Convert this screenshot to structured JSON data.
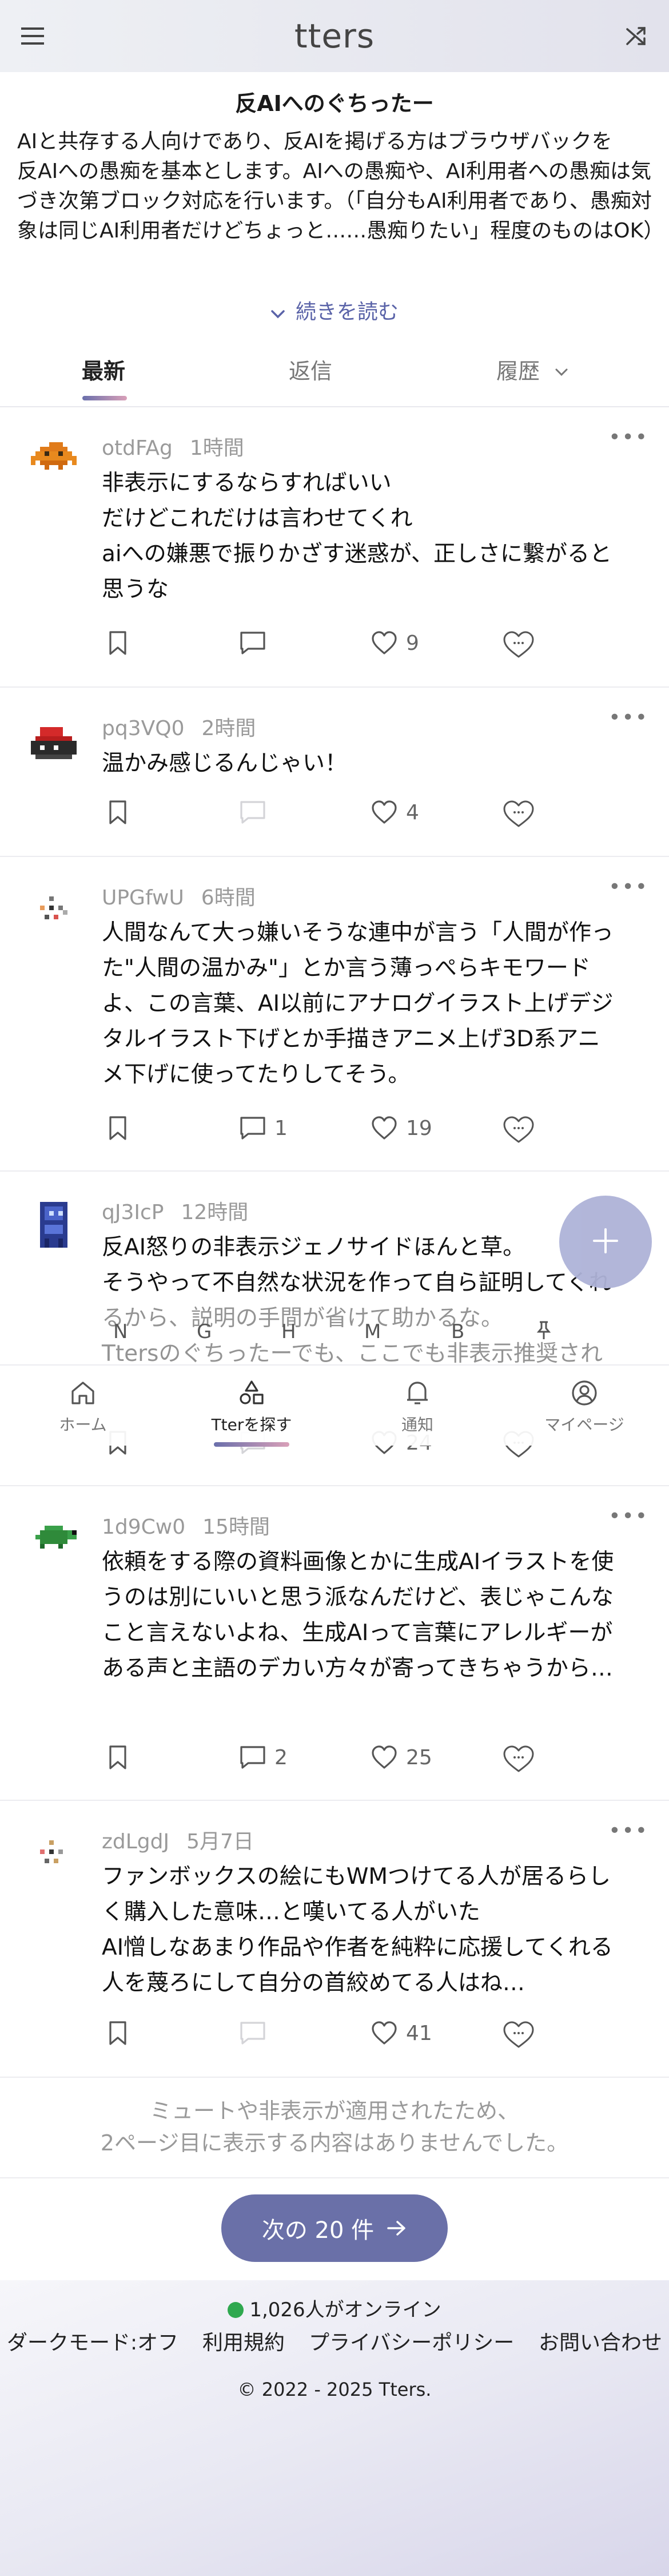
{
  "header": {
    "title": "tters",
    "menu_icon": "hamburger-menu-icon",
    "shuffle_icon": "shuffle-icon"
  },
  "board": {
    "title": "反AIへのぐちったー",
    "description_lines": [
      "AIと共存する人向けであり、反AIを掲げる方はブラウザバックを",
      "反AIへの愚痴を基本とします。AIへの愚痴や、AI利用者への愚痴は気づき次第ブロック対応を行います。（「自分もAI利用者であり、愚痴対象は同じAI利用者だけどちょっと……愚痴りたい」程度のものはOK）"
    ],
    "read_more": "続きを読む"
  },
  "tabs": {
    "latest": "最新",
    "reply": "返信",
    "history": "履歴"
  },
  "posts": [
    {
      "user": "otdFAg",
      "time": "1時間",
      "body": "非表示にするならすればいい\nだけどこれだけは言わせてくれ\naiへの嫌悪で振りかざす迷惑が、正しさに繋がると思うな",
      "comments": "",
      "likes": "9"
    },
    {
      "user": "pq3VQ0",
      "time": "2時間",
      "body": "温かみ感じるんじゃい！",
      "comments": "",
      "likes": "4"
    },
    {
      "user": "UPGfwU",
      "time": "6時間",
      "body": "人間なんて大っ嫌いそうな連中が言う「人間が作った\"人間の温かみ\"」とか言う薄っぺらキモワードよ、この言葉、AI以前にアナログイラスト上げデジタルイラスト下げとか手描きアニメ上げ3D系アニメ下げに使ってたりしてそう。",
      "comments": "1",
      "likes": "19"
    },
    {
      "user": "qJ3IcP",
      "time": "12時間",
      "body": "反AI怒りの非表示ジェノサイドほんと草。\nそうやって不自然な状況を作って自ら証明してくれるから、説明の手間が省けて助かるな。\nTtersのぐちったーでも、ここでも非表示推奨され",
      "comments": "",
      "likes": "24"
    },
    {
      "user": "1d9Cw0",
      "time": "15時間",
      "body": "依頼をする際の資料画像とかに生成AIイラストを使うのは別にいいと思う派なんだけど、表じゃこんなこと言えないよね、生成AIって言葉にアレルギーがある声と主語のデカい方々が寄ってきちゃうから…",
      "comments": "2",
      "likes": "25"
    },
    {
      "user": "zdLgdJ",
      "time": "5月7日",
      "body": "ファンボックスの絵にもWMつけてる人が居るらしく購入した意味…と嘆いてる人がいた\nAI憎しなあまり作品や作者を純粋に応援してくれる人を蔑ろにして自分の首絞めてる人はね…",
      "comments": "",
      "likes": "41"
    }
  ],
  "alpha_row": [
    "N",
    "G",
    "H",
    "M",
    "B"
  ],
  "bottom_nav": {
    "home": "ホーム",
    "explore": "Tterを探す",
    "notify": "通知",
    "mypage": "マイページ"
  },
  "footer": {
    "mute_note_1": "ミュートや非表示が適用されたため、",
    "mute_note_2": "2ページ目に表示する内容はありませんでした。",
    "next_button": "次の 20 件",
    "online": "1,026人がオンライン",
    "dark_mode": "ダークモード:オフ",
    "terms": "利用規約",
    "privacy": "プライバシーポリシー",
    "contact": "お問い合わせ",
    "copyright": "© 2022 - 2025 Tters."
  },
  "colors": {
    "accent": "#6a70a8",
    "online": "#2fa84f"
  }
}
